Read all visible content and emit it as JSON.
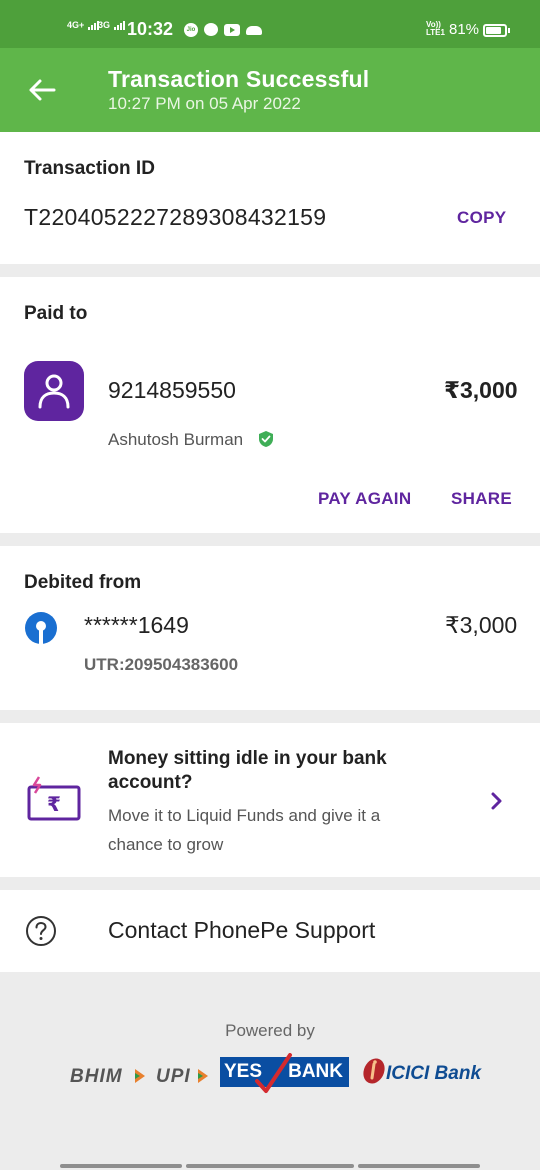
{
  "status_bar": {
    "sim1_label": "4G+",
    "sim2_label": "3G",
    "time": "10:32",
    "jio_badge": "Jio",
    "volte_line1": "Vo))",
    "volte_line2": "LTE1",
    "battery": "81%",
    "battery_level": 0.81,
    "icons": [
      "jio-icon",
      "chat-bubble-icon",
      "youtube-icon",
      "cloud-icon"
    ]
  },
  "header": {
    "title": "Transaction Successful",
    "subtitle": "10:27 PM on 05 Apr 2022",
    "bg_color": "#5fb64a"
  },
  "transaction": {
    "label": "Transaction ID",
    "id": "T2204052227289308432159",
    "copy_label": "COPY"
  },
  "paid_to": {
    "label": "Paid to",
    "number": "9214859550",
    "name": "Ashutosh Burman",
    "amount": "₹3,000",
    "pay_again_label": "PAY AGAIN",
    "share_label": "SHARE"
  },
  "debited_from": {
    "label": "Debited from",
    "account": "******1649",
    "amount": "₹3,000",
    "utr": "UTR:209504383600"
  },
  "promo": {
    "title": "Money sitting idle in your bank account?",
    "body": "Move it to Liquid Funds and give it a chance to grow"
  },
  "support": {
    "label": "Contact PhonePe Support"
  },
  "footer": {
    "powered_by": "Powered by",
    "bhim": "BHIM",
    "upi": "UPI",
    "yes": "YES",
    "bank": "BANK",
    "icici": "ICICI Bank"
  },
  "colors": {
    "accent": "#5f259f",
    "success_green": "#4ea03b",
    "verified_green": "#3fae57"
  }
}
